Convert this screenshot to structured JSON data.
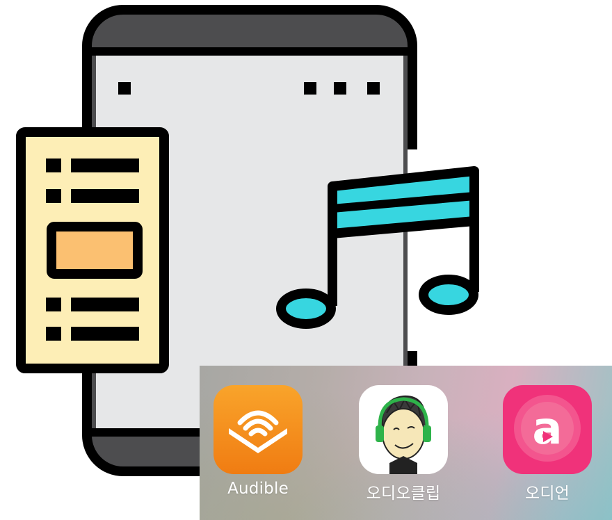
{
  "apps": [
    {
      "label": "Audible",
      "icon": "audible-icon",
      "color": "#f7931e"
    },
    {
      "label": "오디오클립",
      "icon": "audioclip-icon",
      "color": "#ffffff"
    },
    {
      "label": "오디언",
      "icon": "audien-icon",
      "color": "#f0327a"
    }
  ],
  "audien_glyph": "a",
  "illustration": {
    "icon": "tablet-music-icon",
    "colors": {
      "outline": "#000000",
      "bezel": "#4d4d4f",
      "screen": "#e6e7e8",
      "document": "#fdeeb6",
      "document_block": "#fbc071",
      "note_accent": "#37d6e0"
    }
  }
}
